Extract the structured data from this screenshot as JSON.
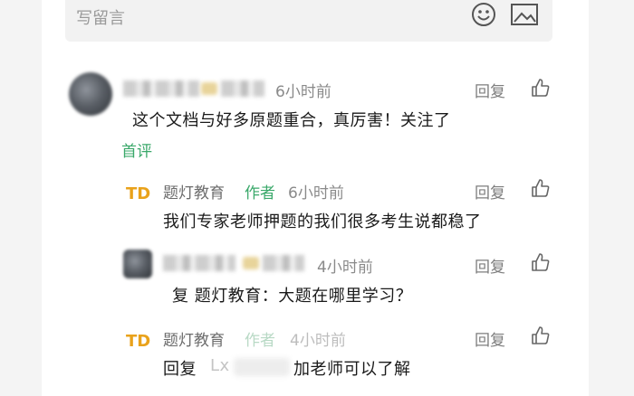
{
  "composer": {
    "placeholder": "写留言",
    "emoji_icon": "smiley-icon",
    "image_icon": "image-icon"
  },
  "comments": [
    {
      "time": "6小时前",
      "text": "这个文档与好多原题重合，真厉害！关注了",
      "badge": "首评",
      "reply_label": "回复"
    }
  ],
  "replies": [
    {
      "author": "题灯教育",
      "author_tag": "作者",
      "time": "6小时前",
      "text": "我们专家老师押题的我们很多考生说都稳了",
      "reply_label": "回复"
    },
    {
      "time": "4小时前",
      "text": "复  题灯教育：大题在哪里学习？",
      "reply_label": "回复"
    },
    {
      "author": "题灯教育",
      "author_tag": "作者",
      "time": "4小时前",
      "text_prefix": "回复",
      "text_faded": "Lx",
      "text_suffix": "加老师可以了解",
      "reply_label": "回复"
    }
  ],
  "colors": {
    "accent_green": "#3aa86a",
    "brand_orange": "#e9a21b",
    "meta_gray": "#8a8a8a"
  }
}
